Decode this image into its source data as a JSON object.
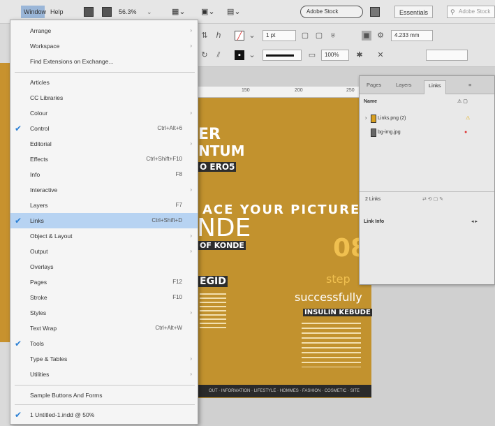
{
  "menubar": {
    "window_label": "Window",
    "help_label": "Help",
    "zoom": "56.3%",
    "adobe_stock_label": "Adobe Stock",
    "workspace_label": "Essentials",
    "search_placeholder": "Adobe Stock"
  },
  "control_bar": {
    "stroke_weight": "1 pt",
    "opacity": "100%",
    "width_value": "4.233 mm"
  },
  "menu": {
    "items": [
      {
        "label": "Arrange",
        "arrow": true
      },
      {
        "label": "Workspace",
        "arrow": true
      },
      {
        "label": "Find Extensions on Exchange...",
        "arrow": false
      },
      {
        "label": "Articles"
      },
      {
        "label": "CC Libraries"
      },
      {
        "label": "Colour",
        "arrow": true
      },
      {
        "label": "Control",
        "shortcut": "Ctrl+Alt+6",
        "checked": true
      },
      {
        "label": "Editorial",
        "arrow": true
      },
      {
        "label": "Effects",
        "shortcut": "Ctrl+Shift+F10"
      },
      {
        "label": "Info",
        "shortcut": "F8"
      },
      {
        "label": "Interactive",
        "arrow": true
      },
      {
        "label": "Layers",
        "shortcut": "F7"
      },
      {
        "label": "Links",
        "shortcut": "Ctrl+Shift+D",
        "checked": true,
        "highlighted": true
      },
      {
        "label": "Object & Layout",
        "arrow": true
      },
      {
        "label": "Output",
        "arrow": true
      },
      {
        "label": "Overlays"
      },
      {
        "label": "Pages",
        "shortcut": "F12"
      },
      {
        "label": "Stroke",
        "shortcut": "F10"
      },
      {
        "label": "Styles",
        "arrow": true
      },
      {
        "label": "Text Wrap",
        "shortcut": "Ctrl+Alt+W"
      },
      {
        "label": "Tools",
        "checked": true
      },
      {
        "label": "Type & Tables",
        "arrow": true
      },
      {
        "label": "Utilities",
        "arrow": true
      },
      {
        "label": "Sample Buttons And Forms"
      },
      {
        "label": "1 Untitled-1.indd @ 50%",
        "checked": true
      }
    ]
  },
  "panel": {
    "tabs": [
      "Pages",
      "Layers",
      "Links"
    ],
    "name_header": "Name",
    "rows": [
      {
        "name": "Links.png (2)",
        "status": "warning"
      },
      {
        "name": "bg-img.jpg",
        "status": "missing"
      }
    ],
    "footer_count": "2 Links",
    "link_info_label": "Link Info"
  },
  "document": {
    "line1": "ER",
    "line2": "NTUM",
    "line3": "O ERO5",
    "place_picture": "ACE YOUR PICTURE",
    "line5": "NDE",
    "line6": "OF KONDE",
    "number": "08",
    "steps": "step",
    "successfully": "successfully",
    "tagline": "INSULIN KEBUDE",
    "egid": "EGID",
    "footer": "OUT · INFORMATION · LIFESTYLE · HOMMES · FASHION · COSMETIC · SITE"
  },
  "colors": {
    "doc_background": "#c2922e",
    "menu_highlight": "#b7d3f2",
    "check": "#2a7fd4"
  }
}
